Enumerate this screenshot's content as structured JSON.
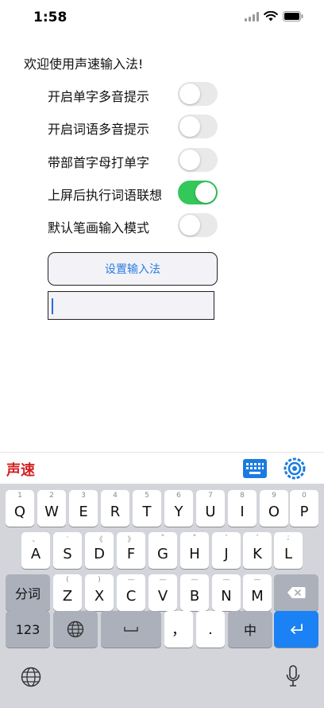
{
  "status_bar": {
    "time": "1:58"
  },
  "welcome_text": "欢迎使用声速输入法!",
  "settings": [
    {
      "label": "开启单字多音提示",
      "on": false
    },
    {
      "label": "开启词语多音提示",
      "on": false
    },
    {
      "label": "带部首字母打单字",
      "on": false
    },
    {
      "label": "上屏后执行词语联想",
      "on": true
    },
    {
      "label": "默认笔画输入模式",
      "on": false
    }
  ],
  "setup_button_label": "设置输入法",
  "test_input": {
    "value": ""
  },
  "keyboard": {
    "brand": "声速",
    "row1": [
      {
        "hint": "1",
        "label": "Q"
      },
      {
        "hint": "2",
        "label": "W"
      },
      {
        "hint": "3",
        "label": "E"
      },
      {
        "hint": "4",
        "label": "R"
      },
      {
        "hint": "5",
        "label": "T"
      },
      {
        "hint": "6",
        "label": "Y"
      },
      {
        "hint": "7",
        "label": "U"
      },
      {
        "hint": "8",
        "label": "I"
      },
      {
        "hint": "9",
        "label": "O"
      },
      {
        "hint": "0",
        "label": "P"
      }
    ],
    "row2": [
      {
        "hint": "、",
        "label": "A"
      },
      {
        "hint": "·",
        "label": "S"
      },
      {
        "hint": "《",
        "label": "D"
      },
      {
        "hint": "》",
        "label": "F"
      },
      {
        "hint": "\"",
        "label": "G"
      },
      {
        "hint": "\"",
        "label": "H"
      },
      {
        "hint": "'",
        "label": "J"
      },
      {
        "hint": "'",
        "label": "K"
      },
      {
        "hint": ";",
        "label": "L"
      }
    ],
    "row3": [
      {
        "hint": "(",
        "label": "Z"
      },
      {
        "hint": ")",
        "label": "X"
      },
      {
        "hint": "—",
        "label": "C"
      },
      {
        "hint": "—",
        "label": "V"
      },
      {
        "hint": "—",
        "label": "B"
      },
      {
        "hint": "—",
        "label": "N"
      },
      {
        "hint": "—",
        "label": "M"
      }
    ],
    "shift_label": "分词",
    "numbers_label": "123",
    "comma_label": "，",
    "period_label": ".",
    "lang_label": "中"
  }
}
